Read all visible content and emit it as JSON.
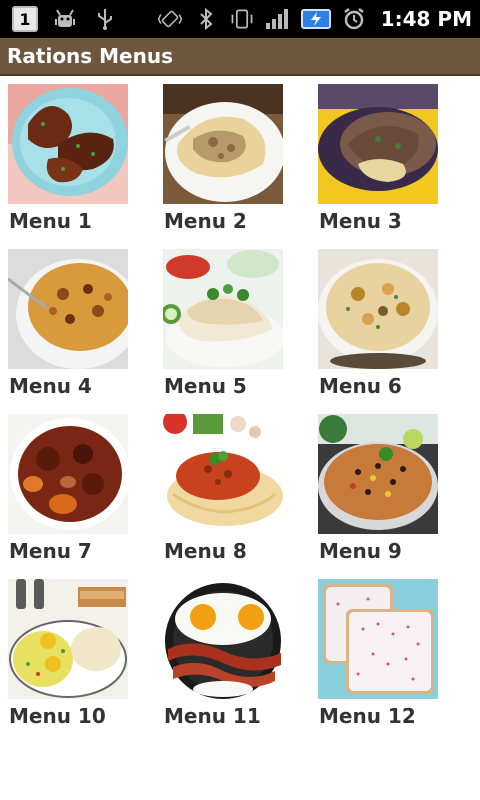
{
  "status_bar": {
    "notification_count": "1",
    "icons": [
      "notification-icon",
      "usb-debug-icon",
      "usb-icon",
      "vibrate-icon",
      "bluetooth-icon",
      "vibrate-mode-icon",
      "signal-icon",
      "battery-charging-icon",
      "alarm-icon"
    ],
    "time": "1:48 PM"
  },
  "app": {
    "title": "Rations Menus",
    "title_bar_color": "#6f563f"
  },
  "menus": [
    {
      "label": "Menu 1",
      "image": "glazed chicken drumsticks"
    },
    {
      "label": "Menu 2",
      "image": "beef stroganoff with noodles"
    },
    {
      "label": "Menu 3",
      "image": "shredded beef over noodles"
    },
    {
      "label": "Menu 4",
      "image": "baked macaroni casserole"
    },
    {
      "label": "Menu 5",
      "image": "chicken and rice"
    },
    {
      "label": "Menu 6",
      "image": "seafood chowder"
    },
    {
      "label": "Menu 7",
      "image": "beef stew"
    },
    {
      "label": "Menu 8",
      "image": "spaghetti bolognese"
    },
    {
      "label": "Menu 9",
      "image": "rice and black beans"
    },
    {
      "label": "Menu 10",
      "image": "eggs and grits"
    },
    {
      "label": "Menu 11",
      "image": "fried eggs and bacon"
    },
    {
      "label": "Menu 12",
      "image": "frosted toaster pastry"
    }
  ]
}
